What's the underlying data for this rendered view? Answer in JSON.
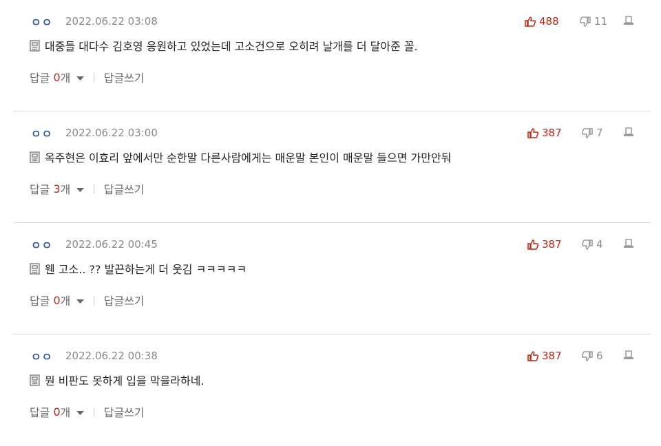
{
  "comments": [
    {
      "user": "ㅇㅇ",
      "date": "2022.06.22 03:08",
      "likes": "488",
      "dislikes": "11",
      "text": "대중들 대다수 김호영 응원하고 있었는데 고소건으로 오히려 날개를 더 달아준 꼴.",
      "reply_label": "답글",
      "reply_count": "0",
      "reply_unit": "개",
      "write_label": "답글쓰기"
    },
    {
      "user": "ㅇㅇ",
      "date": "2022.06.22 03:00",
      "likes": "387",
      "dislikes": "7",
      "text": "옥주현은 이효리 앞에서만 순한말 다른사람에게는 매운말 본인이 매운말 들으면 가만안둬",
      "reply_label": "답글",
      "reply_count": "3",
      "reply_unit": "개",
      "write_label": "답글쓰기"
    },
    {
      "user": "ㅇㅇ",
      "date": "2022.06.22 00:45",
      "likes": "387",
      "dislikes": "4",
      "text": "웬 고소.. ?? 발끈하는게 더 웃김 ㅋㅋㅋㅋㅋ",
      "reply_label": "답글",
      "reply_count": "0",
      "reply_unit": "개",
      "write_label": "답글쓰기"
    },
    {
      "user": "ㅇㅇ",
      "date": "2022.06.22 00:38",
      "likes": "387",
      "dislikes": "6",
      "text": "뭔 비판도 못하게 입을 막을라하네.",
      "reply_label": "답글",
      "reply_count": "0",
      "reply_unit": "개",
      "write_label": "답글쓰기"
    }
  ],
  "colors": {
    "accent_red": "#c9230e",
    "user_blue": "#3c5ea8",
    "muted": "#888888",
    "divider": "#dddddd"
  },
  "icons": [
    "thumbs-up-icon",
    "thumbs-down-icon",
    "report-icon",
    "comment-doc-icon",
    "caret-down-icon"
  ]
}
